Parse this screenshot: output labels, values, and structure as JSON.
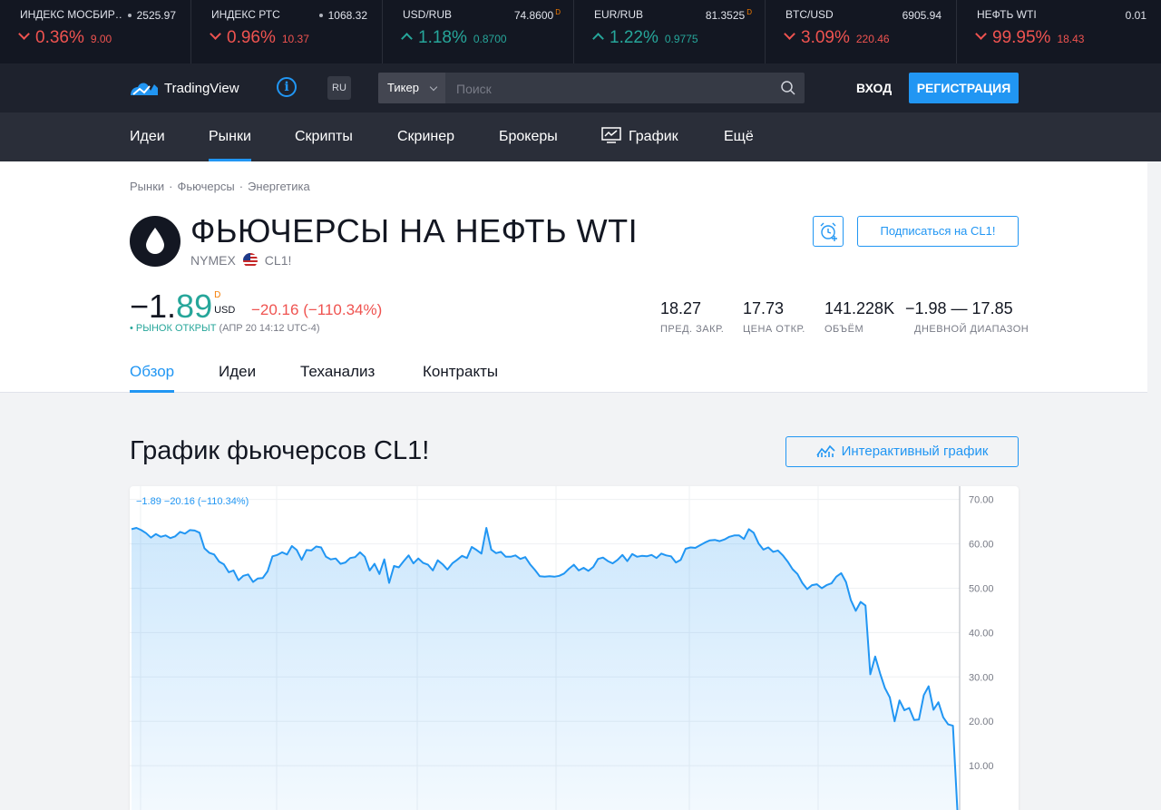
{
  "colors": {
    "accent": "#2196f3",
    "up": "#26a69a",
    "down": "#ef5350",
    "dark": "#131722"
  },
  "tickers": [
    {
      "name": "ИНДЕКС МОСБИР…",
      "value": "2525.97",
      "flag": "",
      "change_pct": "0.36%",
      "change_abs": "9.00",
      "direction": "down",
      "dot": true
    },
    {
      "name": "ИНДЕКС РТС",
      "value": "1068.32",
      "flag": "",
      "change_pct": "0.96%",
      "change_abs": "10.37",
      "direction": "down",
      "dot": true
    },
    {
      "name": "USD/RUB",
      "value": "74.8600",
      "flag": "D",
      "change_pct": "1.18%",
      "change_abs": "0.8700",
      "direction": "up",
      "dot": false
    },
    {
      "name": "EUR/RUB",
      "value": "81.3525",
      "flag": "D",
      "change_pct": "1.22%",
      "change_abs": "0.9775",
      "direction": "up",
      "dot": false
    },
    {
      "name": "BTC/USD",
      "value": "6905.94",
      "flag": "",
      "change_pct": "3.09%",
      "change_abs": "220.46",
      "direction": "down",
      "dot": false
    },
    {
      "name": "НЕФТЬ WTI",
      "value": "0.01",
      "flag": "",
      "change_pct": "99.95%",
      "change_abs": "18.43",
      "direction": "down",
      "dot": false
    }
  ],
  "header": {
    "logo_text": "TradingView",
    "logo_icon": "cloud-chart-icon",
    "lang": "RU",
    "search_type": "Тикер",
    "search_placeholder": "Поиск",
    "login": "ВХОД",
    "register": "РЕГИСТРАЦИЯ"
  },
  "nav": [
    "Идеи",
    "Рынки",
    "Скрипты",
    "Скринер",
    "Брокеры",
    "График",
    "Ещё"
  ],
  "breadcrumb": [
    "Рынки",
    "Фьючерсы",
    "Энергетика"
  ],
  "symbol": {
    "title": "ФЬЮЧЕРСЫ НА НЕФТЬ WTI",
    "exchange": "NYMEX",
    "ticker": "CL1!",
    "follow": "Подписаться на CL1!",
    "price_int": "−1.",
    "price_dec": "89",
    "price_flag": "D",
    "currency": "USD",
    "change": "−20.16 (−110.34%)",
    "market_status": "• РЫНОК ОТКРЫТ",
    "market_time": "(АПР 20 14:12 UTC-4)"
  },
  "stats": [
    {
      "value": "18.27",
      "label": "ПРЕД. ЗАКР."
    },
    {
      "value": "17.73",
      "label": "ЦЕНА ОТКР."
    },
    {
      "value": "141.228K",
      "label": "ОБЪЁМ"
    },
    {
      "value": "−1.98 — 17.85",
      "label": "ДНЕВНОЙ ДИАПАЗОН"
    }
  ],
  "tabs": [
    "Обзор",
    "Идеи",
    "Теханализ",
    "Контракты"
  ],
  "chart_section": {
    "title": "График фьючерсов CL1!",
    "interactive_button": "Интерактивный график",
    "legend": "−1.89 −20.16 (−110.34%)"
  },
  "chart_data": {
    "type": "area",
    "title": "",
    "xlabel": "",
    "ylabel": "",
    "ylim": [
      0,
      73
    ],
    "yticks": [
      "70.00",
      "60.00",
      "50.00",
      "40.00",
      "30.00",
      "20.00",
      "10.00"
    ],
    "grid": true,
    "series": [
      {
        "values": [
          63.3,
          63.6,
          63.1,
          62.4,
          61.4,
          62.2,
          61.6,
          61.9,
          61.3,
          61.7,
          62.7,
          62.3,
          63.1,
          63.0,
          62.5,
          59.0,
          58.0,
          57.6,
          56.0,
          55.4,
          53.6,
          54.0,
          51.8,
          52.8,
          53.1,
          51.4,
          52.2,
          52.3,
          53.8,
          57.2,
          57.5,
          58.1,
          57.6,
          59.5,
          58.6,
          56.4,
          58.6,
          58.5,
          59.4,
          59.2,
          57.1,
          56.5,
          56.7,
          55.5,
          55.8,
          56.8,
          57.0,
          58.1,
          57.1,
          54.0,
          55.5,
          53.2,
          56.5,
          51.2,
          55.0,
          54.7,
          56.1,
          57.4,
          55.6,
          56.7,
          55.7,
          55.3,
          54.0,
          56.3,
          55.4,
          54.2,
          55.6,
          56.4,
          57.3,
          56.8,
          59.3,
          58.6,
          57.8,
          63.6,
          58.7,
          57.9,
          58.2,
          57.1,
          57.1,
          57.4,
          56.6,
          57.0,
          55.4,
          54.1,
          52.7,
          52.6,
          52.7,
          52.6,
          52.8,
          53.3,
          54.4,
          55.3,
          54.0,
          54.6,
          53.9,
          54.8,
          56.6,
          56.9,
          56.1,
          55.6,
          56.4,
          57.5,
          56.1,
          57.7,
          57.1,
          57.3,
          57.2,
          57.5,
          56.8,
          57.8,
          57.4,
          57.2,
          55.8,
          56.4,
          58.9,
          59.2,
          59.1,
          59.7,
          60.3,
          60.8,
          60.9,
          60.6,
          61.0,
          61.6,
          61.9,
          61.9,
          61.1,
          63.3,
          62.5,
          60.1,
          58.7,
          59.2,
          58.2,
          58.5,
          57.4,
          56.0,
          54.3,
          53.2,
          51.2,
          49.8,
          50.7,
          50.9,
          50.0,
          50.7,
          51.1,
          52.6,
          53.4,
          51.4,
          47.3,
          44.9,
          46.9,
          46.1,
          30.6,
          34.6,
          30.8,
          27.5,
          25.4,
          20.0,
          24.7,
          22.5,
          23.0,
          20.3,
          20.4,
          25.9,
          27.9,
          22.6,
          24.3,
          20.9,
          19.3,
          19.0,
          -1.9
        ]
      }
    ]
  }
}
